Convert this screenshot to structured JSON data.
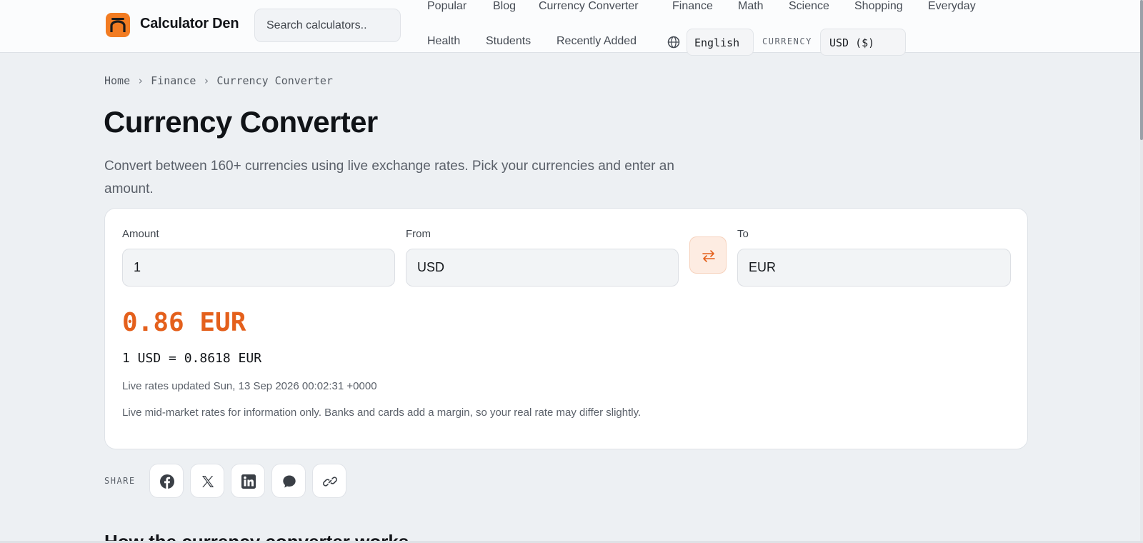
{
  "brand": {
    "name": "Calculator Den"
  },
  "header": {
    "search_placeholder": "Search calculators..",
    "nav": [
      "Popular",
      "Blog",
      "Currency Converter",
      "Finance",
      "Math",
      "Science",
      "Shopping",
      "Everyday",
      "Health",
      "Students",
      "Recently Added"
    ],
    "language": "English",
    "currency_label": "CURRENCY",
    "currency_value": "USD ($)"
  },
  "breadcrumb": [
    "Home",
    "Finance",
    "Currency Converter"
  ],
  "page": {
    "title": "Currency Converter",
    "description": "Convert between 160+ currencies using live exchange rates. Pick your currencies and enter an amount."
  },
  "converter": {
    "amount_label": "Amount",
    "amount_value": "1",
    "from_label": "From",
    "from_value": "USD",
    "to_label": "To",
    "to_value": "EUR",
    "result": "0.86 EUR",
    "rate_line": "1 USD = 0.8618 EUR",
    "updated": "Live rates updated Sun, 13 Sep 2026 00:02:31 +0000",
    "note": "Live mid-market rates for information only. Banks and cards add a margin, so your real rate may differ slightly."
  },
  "share": {
    "label": "SHARE",
    "buttons": [
      "facebook-icon",
      "x-icon",
      "linkedin-icon",
      "message-icon",
      "link-icon"
    ]
  },
  "next_section": {
    "heading": "How the currency converter works"
  },
  "colors": {
    "accent": "#e4601c",
    "logo": "#f27c22",
    "background": "#edf0f3"
  }
}
